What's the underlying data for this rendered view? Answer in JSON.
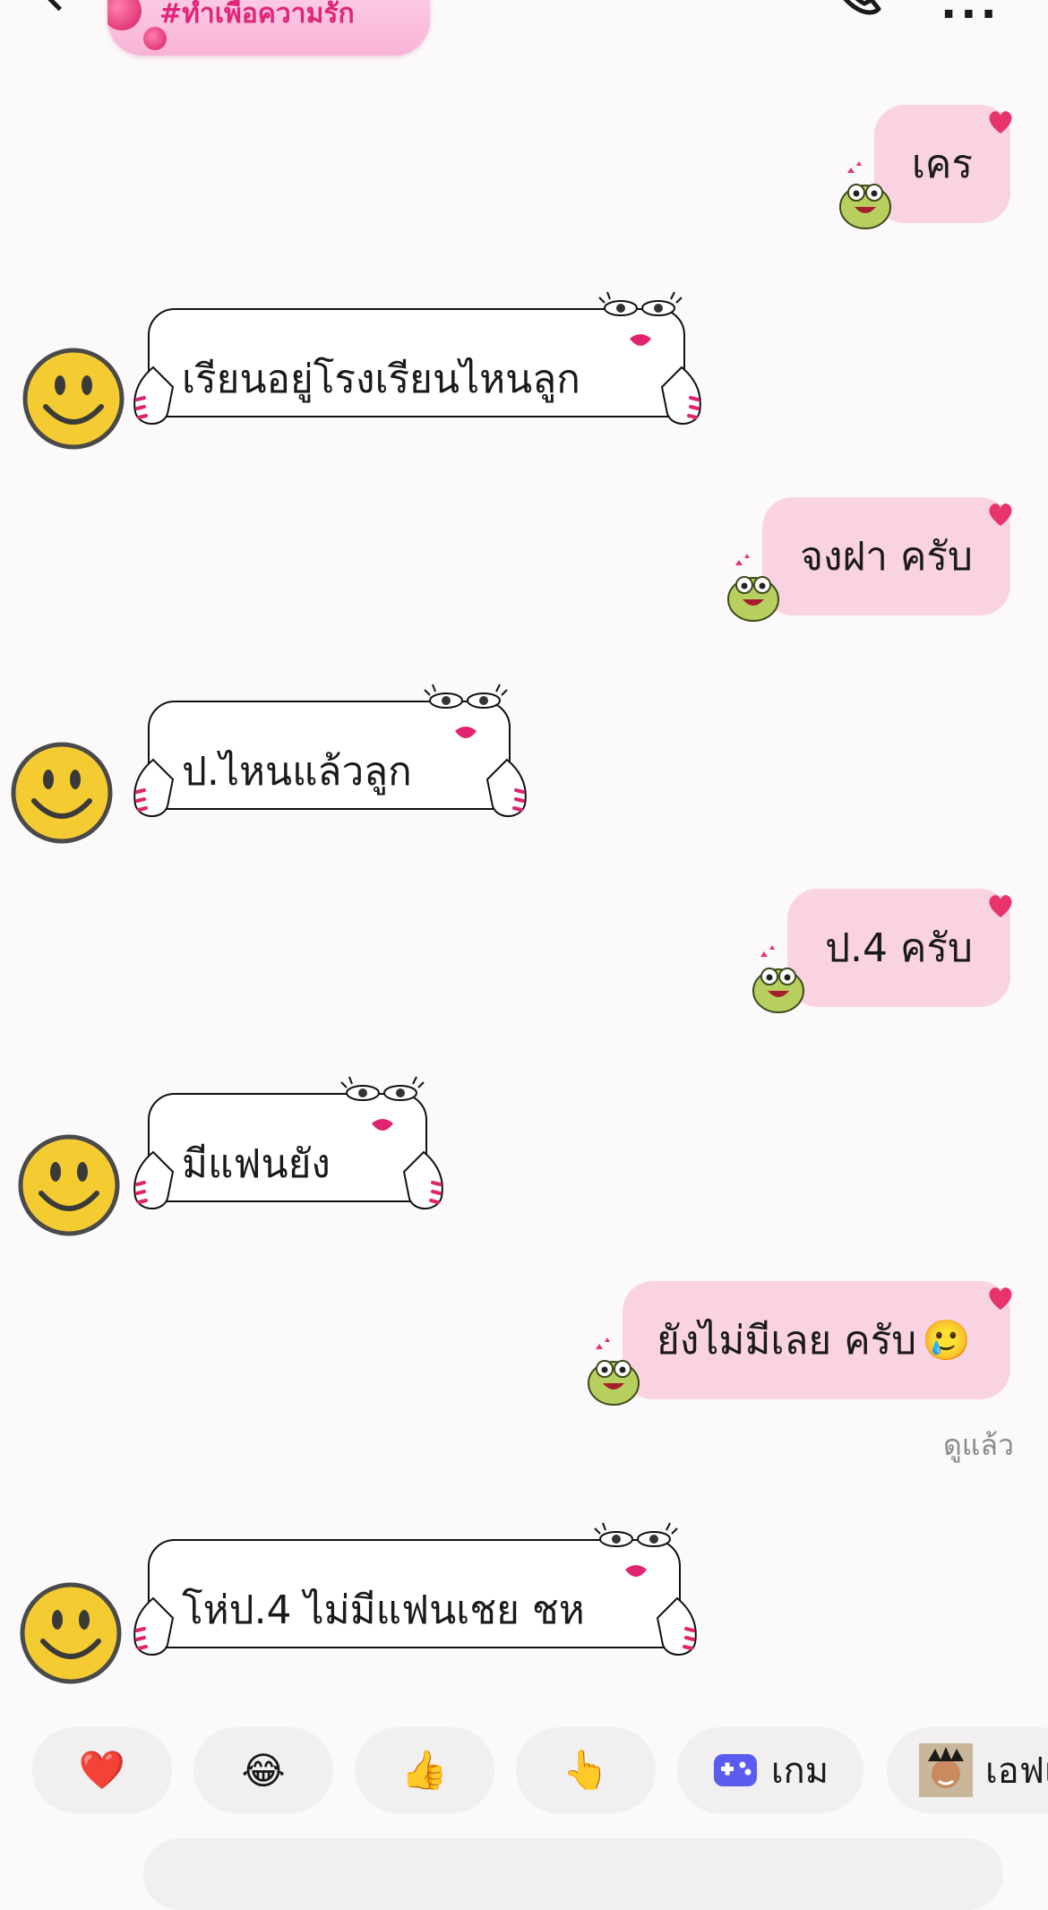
{
  "header": {
    "theme_label": "#ทำเพื่อความรัก",
    "back_icon": "chevron-left-icon",
    "call_icon": "phone-icon",
    "more_icon": "more-icon"
  },
  "messages": [
    {
      "dir": "out",
      "text": "เคร"
    },
    {
      "dir": "in",
      "text": "เรียนอยู่โรงเรียนไหนลูก"
    },
    {
      "dir": "out",
      "text": "จงฝา ครับ"
    },
    {
      "dir": "in",
      "text": "ป.ไหนแล้วลูก"
    },
    {
      "dir": "out",
      "text": "ป.4 ครับ"
    },
    {
      "dir": "in",
      "text": "มีแฟนยัง"
    },
    {
      "dir": "out",
      "text": "ยังไม่มีเลย ครับ",
      "emoji": "🥲"
    },
    {
      "dir": "in",
      "text": "โห่ป.4 ไม่มีแฟนเชย ชห"
    }
  ],
  "seen_status": "ดูแล้ว",
  "quick_replies": [
    {
      "icon": "heart-icon",
      "glyph": "❤️"
    },
    {
      "icon": "tears-of-joy-icon",
      "glyph": "😂"
    },
    {
      "icon": "thumbs-up-icon",
      "glyph": "👍"
    },
    {
      "icon": "pointing-hand-icon",
      "glyph": "👆"
    },
    {
      "icon": "gamepad-icon",
      "label": "เกม"
    },
    {
      "icon": "avatar-icon",
      "label": "เอฟเ"
    }
  ],
  "colors": {
    "bubble_out": "#f9d3e2",
    "accent": "#e8336d",
    "background": "#fbf9fa"
  }
}
